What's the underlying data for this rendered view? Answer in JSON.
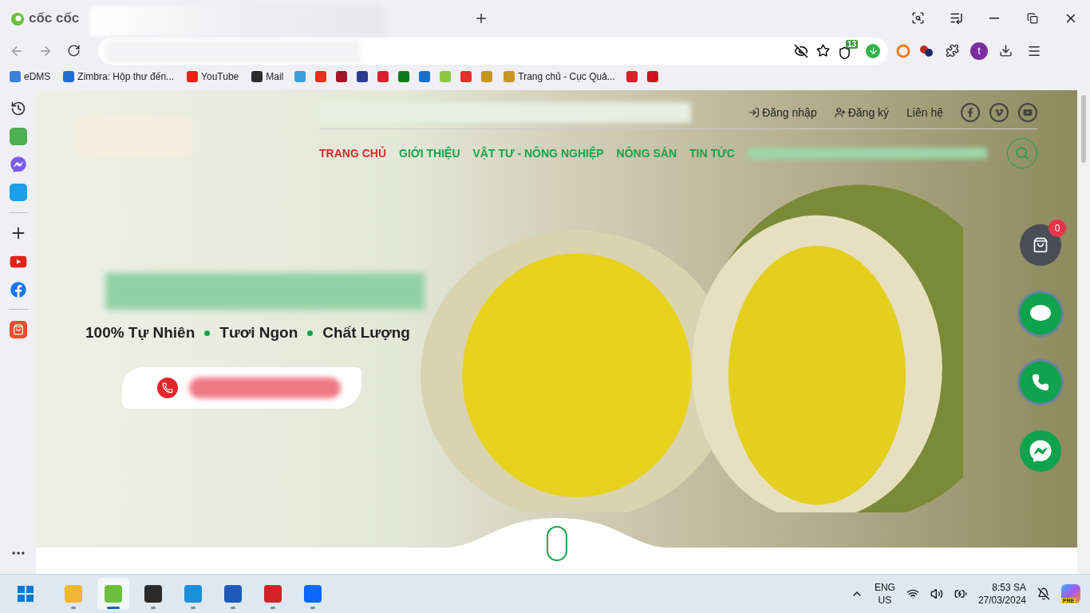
{
  "browser": {
    "logo_text": "cốc cốc",
    "extension_badge": "13",
    "profile_initial": "t",
    "bookmarks": [
      {
        "kind": "text",
        "label": "eDMS",
        "color": "#3b82d6"
      },
      {
        "kind": "text",
        "label": "Zimbra: Hộp thư đến...",
        "color": "#1e6fd0"
      },
      {
        "kind": "text",
        "label": "YouTube",
        "color": "#e62117"
      },
      {
        "kind": "text",
        "label": "Mail",
        "color": "#2d2d2d"
      },
      {
        "kind": "icon",
        "color": "#3aa0d8"
      },
      {
        "kind": "icon",
        "color": "#e0321c"
      },
      {
        "kind": "icon",
        "color": "#a3122b"
      },
      {
        "kind": "icon",
        "color": "#2a3a8c"
      },
      {
        "kind": "icon",
        "color": "#d9202a"
      },
      {
        "kind": "icon",
        "color": "#117a1e"
      },
      {
        "kind": "icon",
        "color": "#1470c8"
      },
      {
        "kind": "icon",
        "color": "#8cc63f"
      },
      {
        "kind": "icon",
        "color": "#e5322d"
      },
      {
        "kind": "icon",
        "color": "#c8961e"
      },
      {
        "kind": "text",
        "label": "Trang chủ - Cục Quả...",
        "color": "#c8961e"
      },
      {
        "kind": "icon",
        "color": "#d42027"
      },
      {
        "kind": "icon",
        "color": "#d0101c"
      }
    ]
  },
  "site": {
    "top_links": [
      {
        "kind": "login",
        "label": "Đăng nhập"
      },
      {
        "kind": "register",
        "label": "Đăng ký"
      },
      {
        "kind": "plain",
        "label": "Liên hệ"
      }
    ],
    "nav": [
      {
        "label": "TRANG CHỦ",
        "selected": true
      },
      {
        "label": "GIỚI THIỆU",
        "selected": false
      },
      {
        "label": "VẬT TƯ - NÔNG NGHIỆP",
        "selected": false
      },
      {
        "label": "NÔNG SẢN",
        "selected": false
      },
      {
        "label": "TIN TỨC",
        "selected": false
      }
    ],
    "tagline": [
      "100% Tự Nhiên",
      "Tươi Ngon",
      "Chất Lượng"
    ],
    "cart_count": "0"
  },
  "taskbar": {
    "apps": [
      {
        "kind": "explorer",
        "active": false
      },
      {
        "kind": "coccoc",
        "active": true
      },
      {
        "kind": "sticky",
        "active": false
      },
      {
        "kind": "edge",
        "active": false
      },
      {
        "kind": "word",
        "active": false
      },
      {
        "kind": "pdf",
        "active": false
      },
      {
        "kind": "zalo",
        "active": false
      }
    ],
    "lang": [
      "ENG",
      "US"
    ],
    "time": "8:53 SA",
    "date": "27/03/2024",
    "copilot_badge": "PRE"
  }
}
